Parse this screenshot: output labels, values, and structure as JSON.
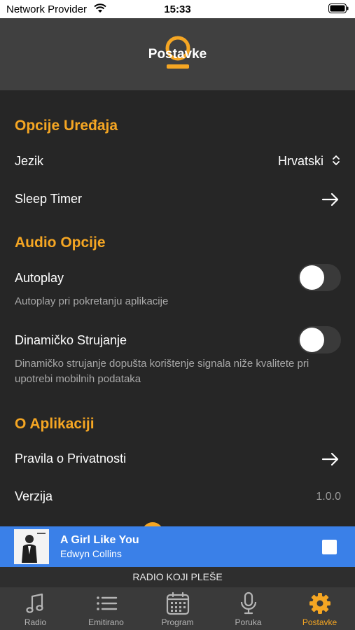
{
  "status_bar": {
    "carrier": "Network Provider",
    "time": "15:33"
  },
  "header": {
    "title": "Postavke"
  },
  "sections": {
    "device": {
      "title": "Opcije Uređaja",
      "language_label": "Jezik",
      "language_value": "Hrvatski",
      "sleep_timer_label": "Sleep Timer"
    },
    "audio": {
      "title": "Audio Opcije",
      "autoplay_label": "Autoplay",
      "autoplay_desc": "Autoplay pri pokretanju aplikacije",
      "autoplay_on": false,
      "dynamic_label": "Dinamičko Strujanje",
      "dynamic_desc": "Dinamičko strujanje dopušta korištenje signala niže kvalitete pri upotrebi mobilnih podataka",
      "dynamic_on": false
    },
    "about": {
      "title": "O Aplikaciji",
      "privacy_label": "Pravila o Privatnosti",
      "version_label": "Verzija",
      "version_value": "1.0.0"
    }
  },
  "now_playing": {
    "song": "A Girl Like You",
    "artist": "Edwyn Collins"
  },
  "station": {
    "slogan": "RADIO KOJI PLEŠE"
  },
  "tabs": [
    {
      "label": "Radio",
      "icon": "music-note-icon",
      "active": false
    },
    {
      "label": "Emitirano",
      "icon": "list-icon",
      "active": false
    },
    {
      "label": "Program",
      "icon": "calendar-icon",
      "active": false
    },
    {
      "label": "Poruka",
      "icon": "microphone-icon",
      "active": false
    },
    {
      "label": "Postavke",
      "icon": "gear-icon",
      "active": true
    }
  ],
  "colors": {
    "accent": "#f5a623",
    "player_bar": "#3a80e8",
    "background": "#262626",
    "header": "#404040"
  }
}
